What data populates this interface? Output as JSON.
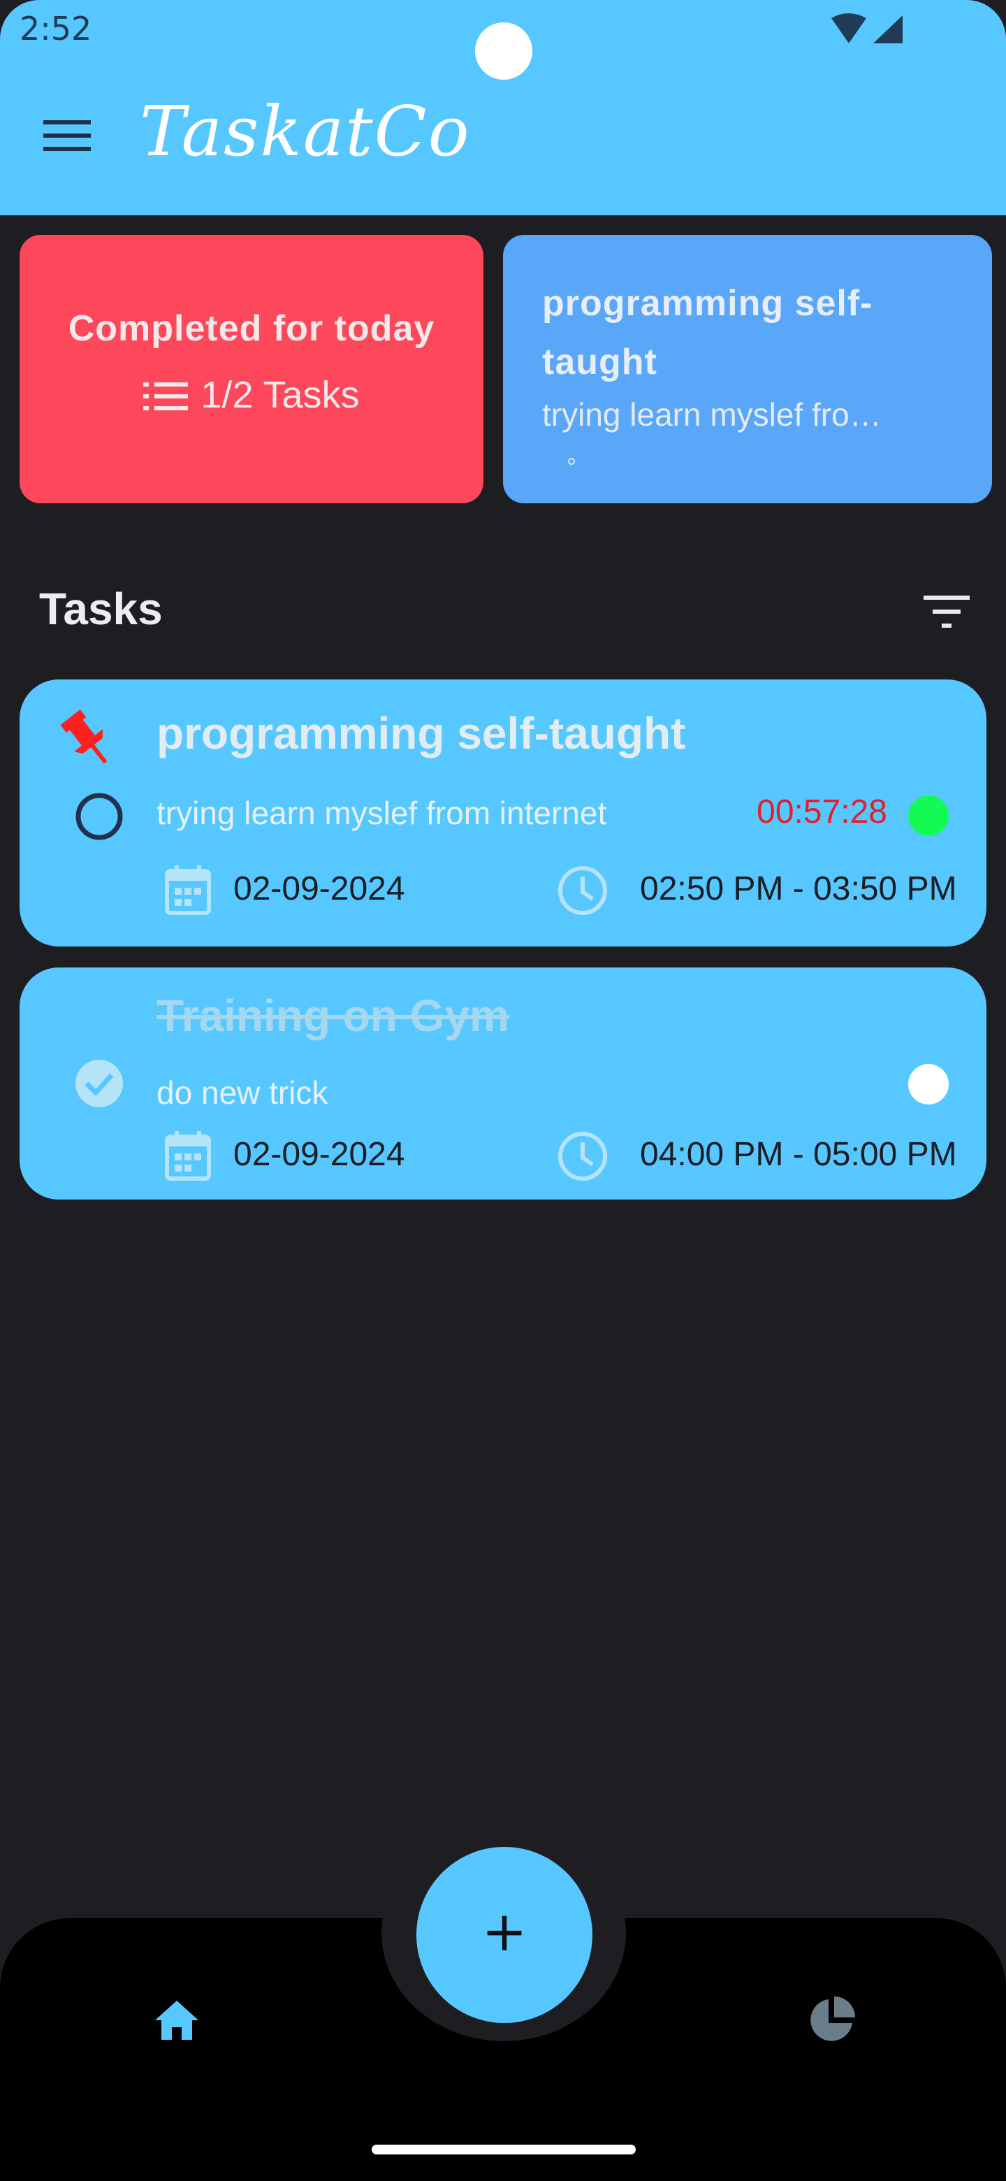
{
  "status_bar": {
    "time": "2:52",
    "icons": [
      "wifi-icon",
      "cellular-icon"
    ]
  },
  "app_bar": {
    "title": "TaskatCo",
    "menu_icon": "menu-icon"
  },
  "summary": {
    "completed_title": "Completed for today",
    "completed_count": "1/2 Tasks",
    "current_task_title": "programming self-taught",
    "current_task_desc": "trying learn myslef fro…"
  },
  "section": {
    "title": "Tasks",
    "filter_icon": "filter-icon"
  },
  "tasks": [
    {
      "title": "programming self-taught",
      "description": "trying learn myslef from internet",
      "timer": "00:57:28",
      "date": "02-09-2024",
      "time_range": "02:50 PM - 03:50 PM",
      "pinned": true,
      "completed": false
    },
    {
      "title": "Training on Gym",
      "description": "do new trick",
      "date": "02-09-2024",
      "time_range": "04:00 PM - 05:00 PM",
      "pinned": false,
      "completed": true
    }
  ],
  "fab": {
    "label": "+"
  },
  "bottom_nav": {
    "items": [
      "home-icon",
      "pie-chart-icon"
    ]
  },
  "colors": {
    "primary": "#56c8ff",
    "background": "#1e1d22",
    "completed_card": "#fd475a",
    "current_card": "#5aa6f9",
    "timer": "#e81c2b",
    "active_dot": "#13fb52"
  }
}
